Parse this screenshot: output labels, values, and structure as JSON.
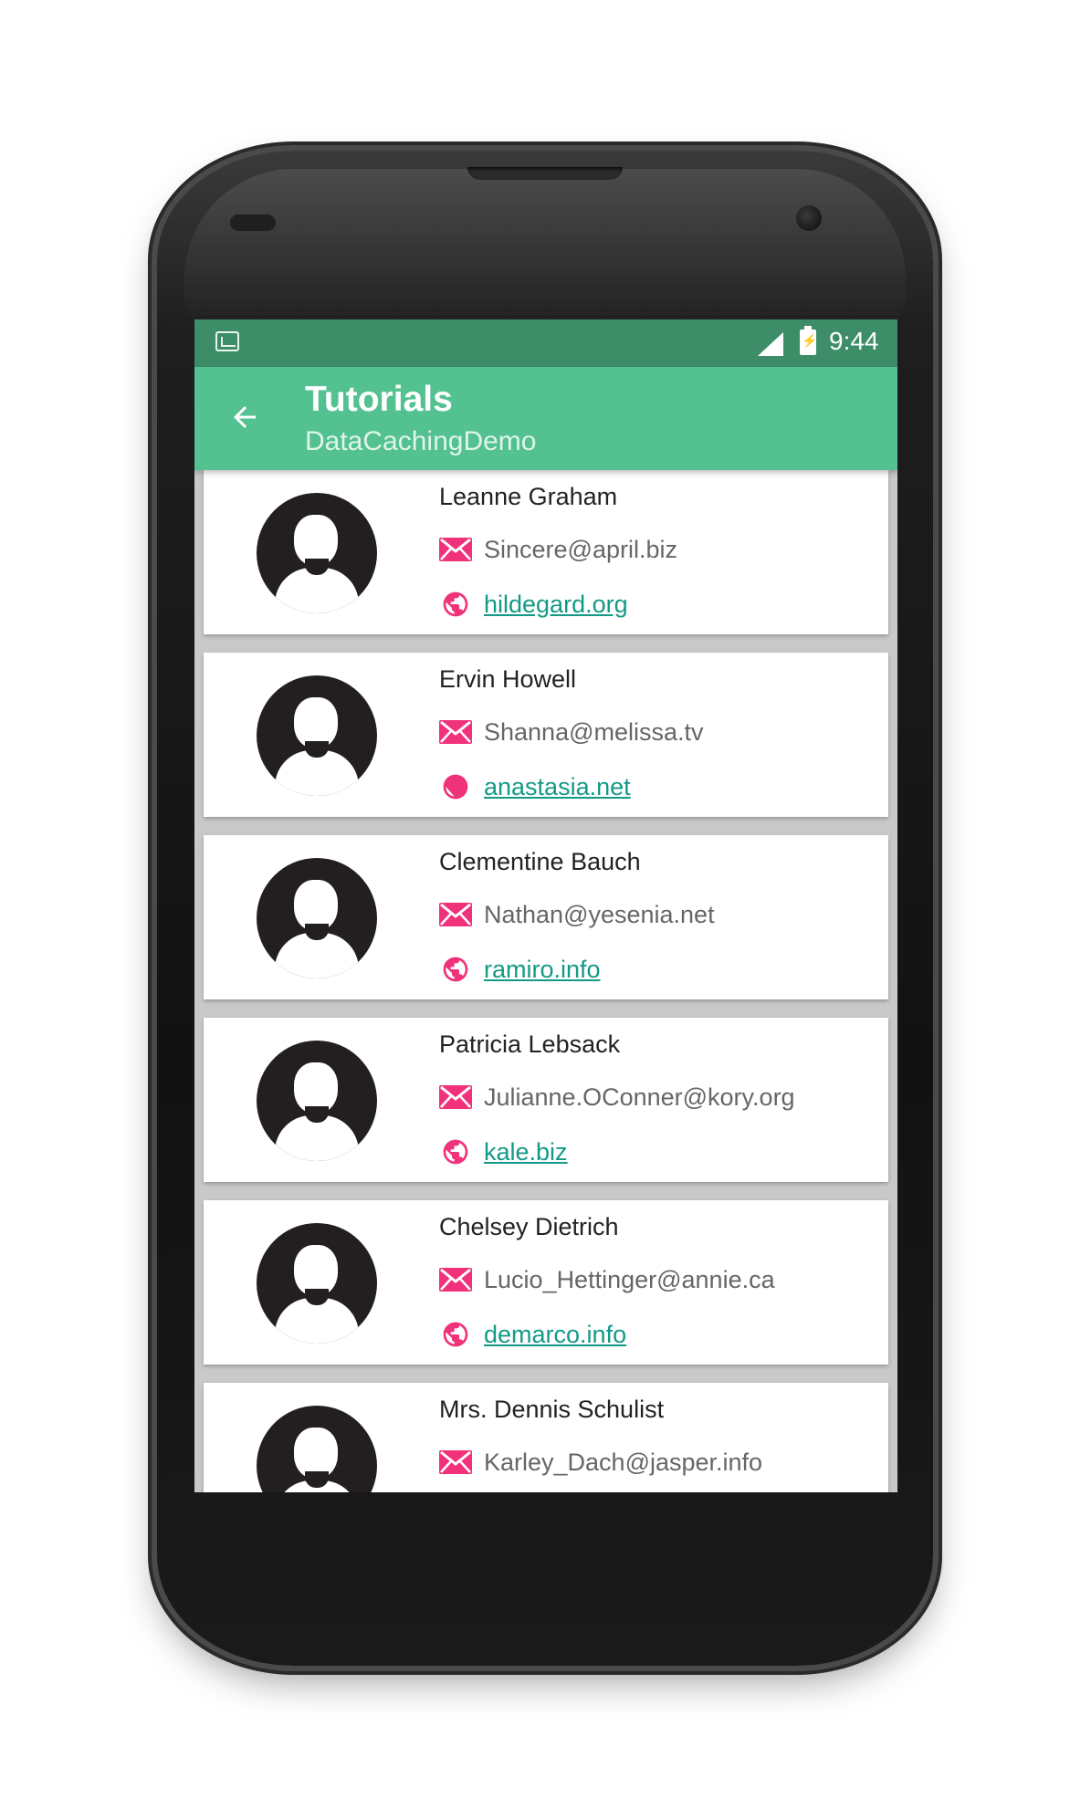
{
  "status_bar": {
    "time": "9:44"
  },
  "app_bar": {
    "title": "Tutorials",
    "subtitle": "DataCachingDemo"
  },
  "colors": {
    "status_bar": "#3e8d69",
    "app_bar": "#53c190",
    "icon_accent": "#f0327a",
    "link": "#139a86"
  },
  "users": [
    {
      "name": "Leanne Graham",
      "email": "Sincere@april.biz",
      "website": "hildegard.org"
    },
    {
      "name": "Ervin Howell",
      "email": "Shanna@melissa.tv",
      "website": "anastasia.net"
    },
    {
      "name": "Clementine Bauch",
      "email": "Nathan@yesenia.net",
      "website": "ramiro.info"
    },
    {
      "name": "Patricia Lebsack",
      "email": "Julianne.OConner@kory.org",
      "website": "kale.biz"
    },
    {
      "name": "Chelsey Dietrich",
      "email": "Lucio_Hettinger@annie.ca",
      "website": "demarco.info"
    },
    {
      "name": "Mrs. Dennis Schulist",
      "email": "Karley_Dach@jasper.info",
      "website": ""
    }
  ]
}
